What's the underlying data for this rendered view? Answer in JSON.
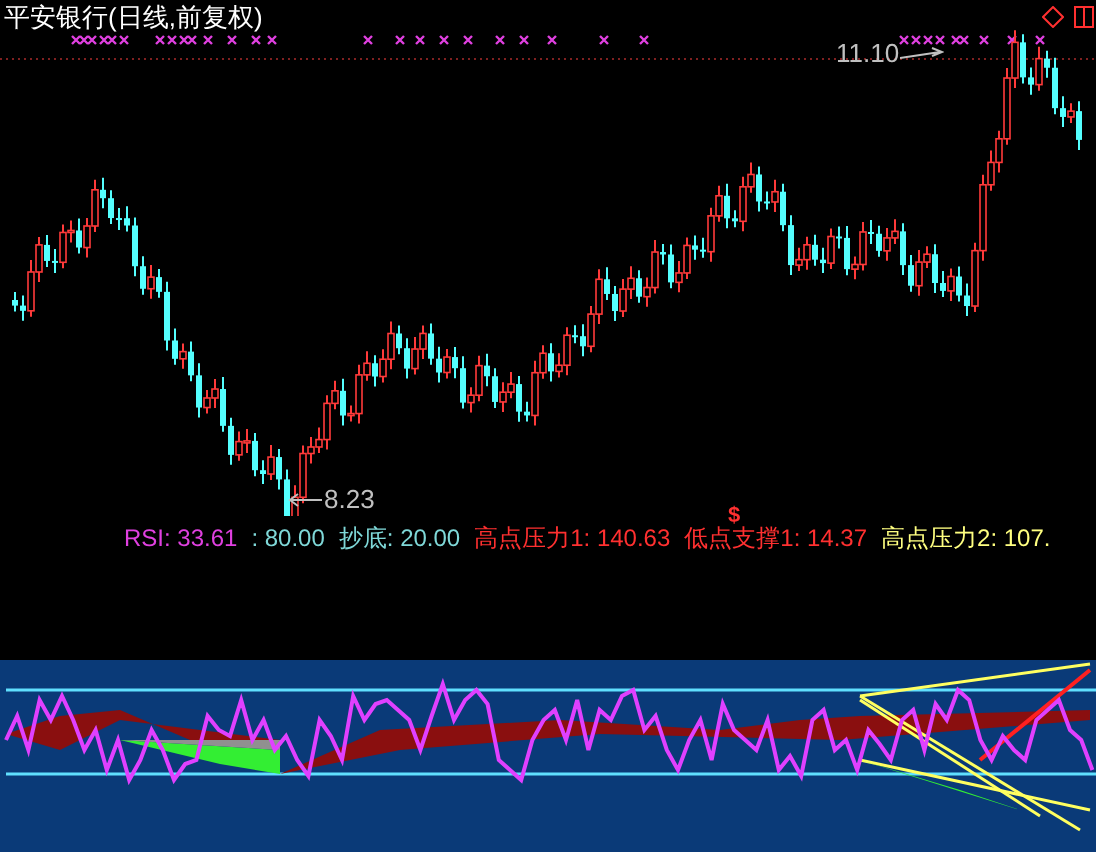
{
  "chart": {
    "title": "平安银行(日线,前复权)",
    "high_label": "11.10",
    "low_label": "8.23",
    "signal_mark": "$"
  },
  "indicator": {
    "readouts": [
      {
        "text": "RSI: 33.61",
        "color": "#e040e0"
      },
      {
        "text": ": 80.00",
        "color": "#7fd8d8"
      },
      {
        "text": "抄底: 20.00",
        "color": "#7fd8d8"
      },
      {
        "text": "高点压力1: 140.63",
        "color": "#ff3030"
      },
      {
        "text": "低点支撑1: 14.37",
        "color": "#ff3030"
      },
      {
        "text": "高点压力2: 107.",
        "color": "#ffff80"
      }
    ]
  }
}
